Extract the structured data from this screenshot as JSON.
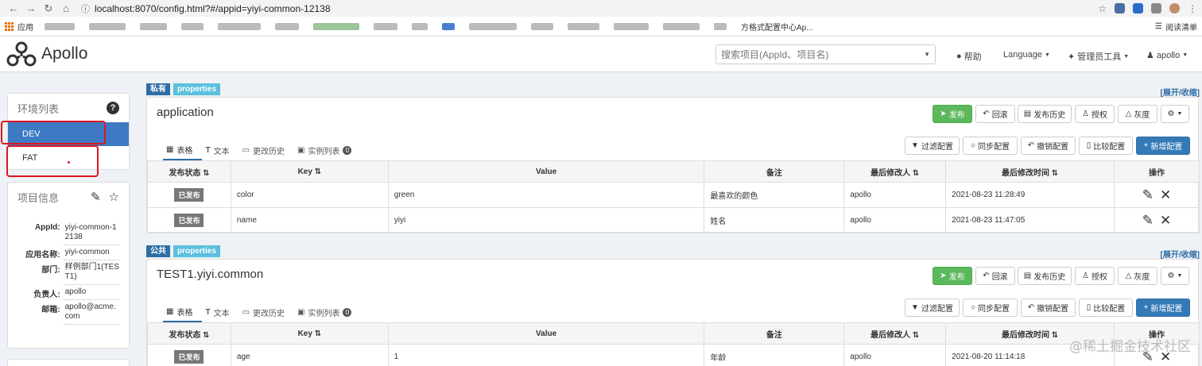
{
  "browser": {
    "url": "localhost:8070/config.html?#/appid=yiyi-common-12138",
    "bookmarks_apps": "应用",
    "bookmark_visible": "方格式配置中心Ap...",
    "reading_list": "阅读清单"
  },
  "header": {
    "logo_text": "Apollo",
    "search_placeholder": "搜索项目(AppId、项目名)",
    "help": "帮助",
    "language": "Language",
    "admin_tools": "管理员工具",
    "user": "apollo"
  },
  "env_panel": {
    "title": "环境列表",
    "envs": [
      "DEV",
      "FAT"
    ]
  },
  "project_info": {
    "title": "项目信息",
    "rows": [
      {
        "label": "AppId:",
        "value": "yiyi-common-12138"
      },
      {
        "label": "应用名称:",
        "value": "yiyi-common"
      },
      {
        "label": "部门:",
        "value": "样例部门1(TEST1)"
      },
      {
        "label": "负责人:",
        "value": "apollo"
      },
      {
        "label": "邮箱:",
        "value": "apollo@acme.com"
      }
    ]
  },
  "common": {
    "expand_collapse": "[展开/收缩]",
    "buttons": {
      "publish": "发布",
      "rollback": "回滚",
      "publish_history": "发布历史",
      "authorize": "授权",
      "gray": "灰度",
      "filter": "过滤配置",
      "sync": "同步配置",
      "revoke": "撤销配置",
      "compare": "比较配置",
      "add": "新增配置"
    },
    "tabs": {
      "table": "表格",
      "text": "文本",
      "history": "更改历史",
      "instances": "实例列表",
      "instances_count": "0"
    },
    "columns": {
      "status": "发布状态",
      "key": "Key",
      "value": "Value",
      "comment": "备注",
      "modifier": "最后修改人",
      "modified_time": "最后修改时间",
      "ops": "操作"
    },
    "published": "已发布",
    "format_tag": "properties"
  },
  "namespaces": [
    {
      "scope": "私有",
      "name": "application",
      "rows": [
        {
          "key": "color",
          "value": "green",
          "comment": "最喜欢的颜色",
          "modifier": "apollo",
          "time": "2021-08-23 11:28:49"
        },
        {
          "key": "name",
          "value": "yiyi",
          "comment": "姓名",
          "modifier": "apollo",
          "time": "2021-08-23 11:47:05"
        }
      ]
    },
    {
      "scope": "公共",
      "name": "TEST1.yiyi.common",
      "rows": [
        {
          "key": "age",
          "value": "1",
          "comment": "年龄",
          "modifier": "apollo",
          "time": "2021-08-20 11:14:18"
        }
      ]
    }
  ],
  "watermark": "@稀土掘金技术社区",
  "colors": {
    "primary": "#337ab7",
    "success": "#5cb85c",
    "info": "#5bc0de",
    "highlight": "#e0141e"
  }
}
